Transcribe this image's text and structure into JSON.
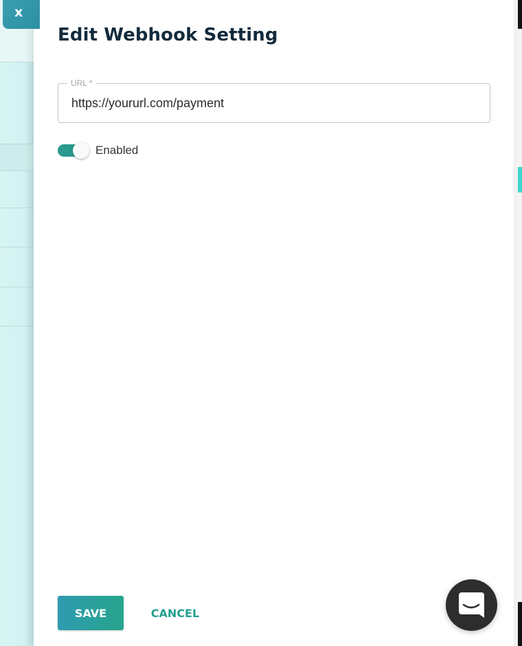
{
  "close_tab": {
    "label": "x"
  },
  "drawer": {
    "title": "Edit Webhook Setting",
    "url_field": {
      "label": "URL *",
      "value": "https://yoururl.com/payment"
    },
    "enabled_toggle": {
      "label": "Enabled",
      "checked": true
    },
    "actions": {
      "save_label": "SAVE",
      "cancel_label": "CANCEL"
    }
  },
  "chat_launcher": {
    "icon": "chat-icon"
  },
  "colors": {
    "title": "#132b3c",
    "accent": "#2a9a8e",
    "save_gradient_start": "#2f9bb0",
    "save_gradient_end": "#26a58c",
    "cancel_text": "#23a08f",
    "chat_bubble": "#2d2d2d"
  }
}
